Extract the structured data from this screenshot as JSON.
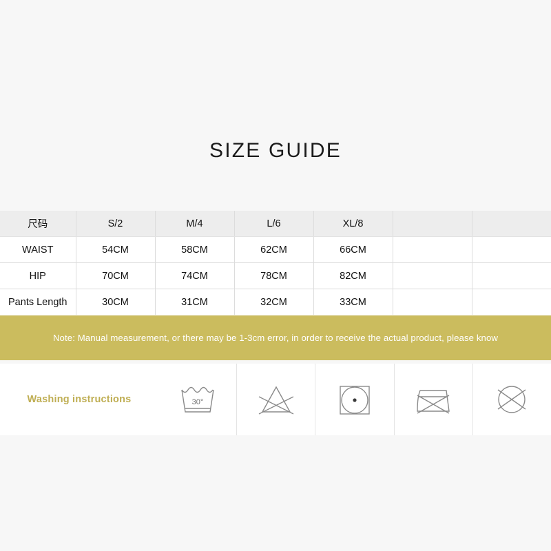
{
  "page": {
    "title": "SIZE GUIDE",
    "background_color": "#f7f7f7",
    "accent_color": "#cbbc5e"
  },
  "size_table": {
    "columns": [
      {
        "key": "label",
        "header": "尺码"
      },
      {
        "key": "s",
        "header": "S/2"
      },
      {
        "key": "m",
        "header": "M/4"
      },
      {
        "key": "l",
        "header": "L/6"
      },
      {
        "key": "xl",
        "header": "XL/8"
      },
      {
        "key": "empty1",
        "header": ""
      },
      {
        "key": "empty2",
        "header": ""
      }
    ],
    "rows": [
      {
        "label": "WAIST",
        "s": "54CM",
        "m": "58CM",
        "l": "62CM",
        "xl": "66CM",
        "empty1": "",
        "empty2": ""
      },
      {
        "label": "HIP",
        "s": "70CM",
        "m": "74CM",
        "l": "78CM",
        "xl": "82CM",
        "empty1": "",
        "empty2": ""
      },
      {
        "label": "Pants Length",
        "s": "30CM",
        "m": "31CM",
        "l": "32CM",
        "xl": "33CM",
        "empty1": "",
        "empty2": ""
      }
    ]
  },
  "note": {
    "text": "Note: Manual measurement, or there may be 1-3cm error, in order to receive the actual product, please know",
    "background_color": "#cbbc5e",
    "text_color": "#ffffff"
  },
  "washing": {
    "label": "Washing instructions",
    "label_color": "#bfae53",
    "icons": [
      {
        "name": "machine-wash-30-icon",
        "meaning": "Machine wash at 30°C",
        "temperature": "30°"
      },
      {
        "name": "do-not-bleach-icon",
        "meaning": "Do not bleach",
        "temperature": ""
      },
      {
        "name": "tumble-dry-low-icon",
        "meaning": "Tumble dry low heat",
        "temperature": ""
      },
      {
        "name": "do-not-iron-icon",
        "meaning": "Do not iron",
        "temperature": ""
      },
      {
        "name": "do-not-dry-clean-icon",
        "meaning": "Do not dry clean",
        "temperature": ""
      }
    ]
  }
}
